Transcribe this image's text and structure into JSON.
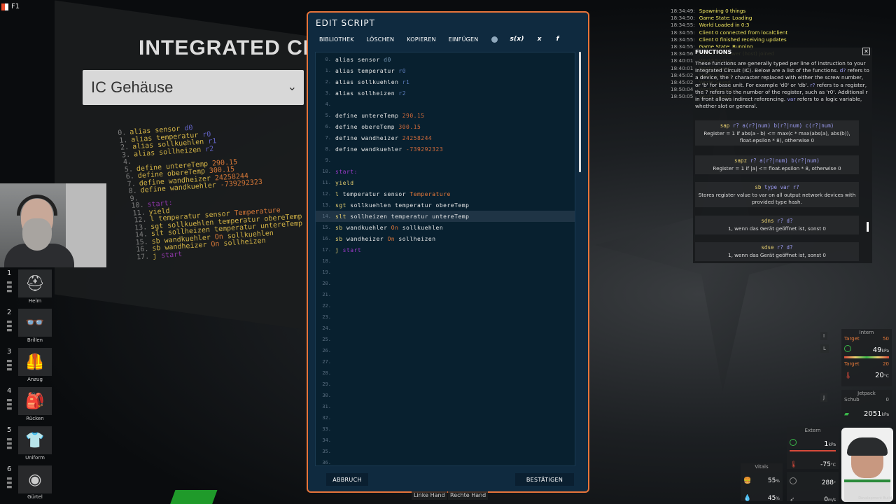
{
  "top_left": {
    "key": "F1"
  },
  "background": {
    "title": "INTEGRATED CIRCUIT",
    "selector_value": "IC Gehäuse"
  },
  "background_code": [
    {
      "n": "0.",
      "parts": [
        [
          "kw",
          "alias sensor "
        ],
        [
          "dev",
          "d0"
        ]
      ]
    },
    {
      "n": "1.",
      "parts": [
        [
          "kw",
          "alias temperatur "
        ],
        [
          "reg",
          "r0"
        ]
      ]
    },
    {
      "n": "2.",
      "parts": [
        [
          "kw",
          "alias sollkuehlen "
        ],
        [
          "reg",
          "r1"
        ]
      ]
    },
    {
      "n": "3.",
      "parts": [
        [
          "kw",
          "alias sollheizen "
        ],
        [
          "reg",
          "r2"
        ]
      ]
    },
    {
      "n": "4.",
      "parts": []
    },
    {
      "n": "5.",
      "parts": [
        [
          "kw",
          "define untereTemp "
        ],
        [
          "num",
          "290.15"
        ]
      ]
    },
    {
      "n": "6.",
      "parts": [
        [
          "kw",
          "define obereTemp "
        ],
        [
          "num",
          "300.15"
        ]
      ]
    },
    {
      "n": "7.",
      "parts": [
        [
          "kw",
          "define wandheizer "
        ],
        [
          "num",
          "24258244"
        ]
      ]
    },
    {
      "n": "8.",
      "parts": [
        [
          "kw",
          "define wandkuehler "
        ],
        [
          "num",
          "-739292323"
        ]
      ]
    },
    {
      "n": "9.",
      "parts": []
    },
    {
      "n": "10.",
      "parts": [
        [
          "lbl",
          "start:"
        ]
      ]
    },
    {
      "n": "11.",
      "parts": [
        [
          "kw",
          "yield"
        ]
      ]
    },
    {
      "n": "12.",
      "parts": [
        [
          "kw",
          "l temperatur sensor "
        ],
        [
          "logic",
          "Temperature"
        ]
      ]
    },
    {
      "n": "13.",
      "parts": [
        [
          "kw",
          "sgt sollkuehlen temperatur obereTemp"
        ]
      ]
    },
    {
      "n": "14.",
      "parts": [
        [
          "kw",
          "slt sollheizen temperatur untereTemp"
        ]
      ]
    },
    {
      "n": "15.",
      "parts": [
        [
          "kw",
          "sb wandkuehler "
        ],
        [
          "logic",
          "On"
        ],
        [
          "kw",
          " sollkuehlen"
        ]
      ]
    },
    {
      "n": "16.",
      "parts": [
        [
          "kw",
          "sb wandheizer "
        ],
        [
          "logic",
          "On"
        ],
        [
          "kw",
          " sollheizen"
        ]
      ]
    },
    {
      "n": "17.",
      "parts": [
        [
          "kw",
          "j "
        ],
        [
          "lbl",
          "start"
        ]
      ]
    }
  ],
  "inventory": [
    {
      "num": "1",
      "label": "Helm",
      "icon": "helmet-icon",
      "glyph": "⛑"
    },
    {
      "num": "2",
      "label": "Brillen",
      "icon": "glasses-icon",
      "glyph": "👓"
    },
    {
      "num": "3",
      "label": "Anzug",
      "icon": "suit-icon",
      "glyph": "🦺"
    },
    {
      "num": "4",
      "label": "Rücken",
      "icon": "backpack-icon",
      "glyph": "🎒"
    },
    {
      "num": "5",
      "label": "Uniform",
      "icon": "uniform-icon",
      "glyph": "👕"
    },
    {
      "num": "6",
      "label": "Gürtel",
      "icon": "belt-icon",
      "glyph": "◉"
    }
  ],
  "modal": {
    "title": "EDIT SCRIPT",
    "toolbar": [
      "BIBLIOTHEK",
      "LÖSCHEN",
      "KOPIEREN",
      "EINFÜGEN"
    ],
    "toolbar_icons": [
      "s(x)",
      "x",
      "f"
    ],
    "cancel": "ABBRUCH",
    "confirm": "BESTÄTIGEN",
    "active_line": 14
  },
  "code_lines": [
    {
      "n": "0.",
      "parts": [
        [
          "plain",
          "alias "
        ],
        [
          "plain",
          "sensor "
        ],
        [
          "dev",
          "d0"
        ]
      ]
    },
    {
      "n": "1.",
      "parts": [
        [
          "plain",
          "alias temperatur "
        ],
        [
          "reg",
          "r0"
        ]
      ]
    },
    {
      "n": "2.",
      "parts": [
        [
          "plain",
          "alias sollkuehlen "
        ],
        [
          "reg",
          "r1"
        ]
      ]
    },
    {
      "n": "3.",
      "parts": [
        [
          "plain",
          "alias sollheizen "
        ],
        [
          "reg",
          "r2"
        ]
      ]
    },
    {
      "n": "4.",
      "parts": []
    },
    {
      "n": "5.",
      "parts": [
        [
          "plain",
          "define untereTemp "
        ],
        [
          "num",
          "290.15"
        ]
      ]
    },
    {
      "n": "6.",
      "parts": [
        [
          "plain",
          "define obereTemp "
        ],
        [
          "num",
          "300.15"
        ]
      ]
    },
    {
      "n": "7.",
      "parts": [
        [
          "plain",
          "define wandheizer "
        ],
        [
          "num",
          "24258244"
        ]
      ]
    },
    {
      "n": "8.",
      "parts": [
        [
          "plain",
          "define wandkuehler "
        ],
        [
          "num",
          "-739292323"
        ]
      ]
    },
    {
      "n": "9.",
      "parts": []
    },
    {
      "n": "10.",
      "parts": [
        [
          "lbl",
          "start:"
        ]
      ]
    },
    {
      "n": "11.",
      "parts": [
        [
          "kw",
          "yield"
        ]
      ]
    },
    {
      "n": "12.",
      "parts": [
        [
          "kw",
          "l "
        ],
        [
          "plain",
          "temperatur sensor "
        ],
        [
          "logic",
          "Temperature"
        ]
      ]
    },
    {
      "n": "13.",
      "parts": [
        [
          "kw",
          "sgt "
        ],
        [
          "plain",
          "sollkuehlen temperatur obereTemp"
        ]
      ]
    },
    {
      "n": "14.",
      "parts": [
        [
          "kw",
          "slt "
        ],
        [
          "plain",
          "sollheizen temperatur untereTemp"
        ]
      ]
    },
    {
      "n": "15.",
      "parts": [
        [
          "kw",
          "sb "
        ],
        [
          "plain",
          "wandkuehler "
        ],
        [
          "logic",
          "On"
        ],
        [
          "plain",
          " sollkuehlen"
        ]
      ]
    },
    {
      "n": "16.",
      "parts": [
        [
          "kw",
          "sb "
        ],
        [
          "plain",
          "wandheizer "
        ],
        [
          "logic",
          "On"
        ],
        [
          "plain",
          " sollheizen"
        ]
      ]
    },
    {
      "n": "17.",
      "parts": [
        [
          "kw",
          "j "
        ],
        [
          "lbl",
          "start"
        ]
      ]
    },
    {
      "n": "18.",
      "parts": []
    },
    {
      "n": "19.",
      "parts": []
    },
    {
      "n": "20.",
      "parts": []
    },
    {
      "n": "21.",
      "parts": []
    },
    {
      "n": "22.",
      "parts": []
    },
    {
      "n": "23.",
      "parts": []
    },
    {
      "n": "24.",
      "parts": []
    },
    {
      "n": "25.",
      "parts": []
    },
    {
      "n": "26.",
      "parts": []
    },
    {
      "n": "27.",
      "parts": []
    },
    {
      "n": "28.",
      "parts": []
    },
    {
      "n": "29.",
      "parts": []
    },
    {
      "n": "30.",
      "parts": []
    },
    {
      "n": "31.",
      "parts": []
    },
    {
      "n": "32.",
      "parts": []
    },
    {
      "n": "33.",
      "parts": []
    },
    {
      "n": "34.",
      "parts": []
    },
    {
      "n": "35.",
      "parts": []
    },
    {
      "n": "36.",
      "parts": []
    }
  ],
  "log": [
    {
      "ts": "18:34:49:",
      "msg": "Spawning 0 things"
    },
    {
      "ts": "18:34:50:",
      "msg": "Game State: Loading"
    },
    {
      "ts": "18:34:55:",
      "msg": "World Loaded in 0:3"
    },
    {
      "ts": "18:34:55:",
      "msg": "Client 0 connected from localClient"
    },
    {
      "ts": "18:34:55:",
      "msg": "Client 0 finished receiving updates"
    },
    {
      "ts": "18:34:55:",
      "msg": "Game State: Running"
    },
    {
      "ts": "18:34:56:",
      "msg": "Player Funpower (host) joined"
    },
    {
      "ts": "18:40:01:",
      "msg": "World Saving"
    },
    {
      "ts": "18:40:01:",
      "msg": "World Saved"
    },
    {
      "ts": "18:45:02:",
      "msg": "World Saving"
    },
    {
      "ts": "18:45:02:",
      "msg": "World Saved"
    },
    {
      "ts": "18:50:04:",
      "msg": "World Saving"
    },
    {
      "ts": "18:50:05:",
      "msg": "World Saved"
    }
  ],
  "functions": {
    "title": "FUNCTIONS",
    "intro_a": "These functions are generally typed per line of instruction to your Integrated Circuit (IC). Below are a list of the functions. ",
    "intro_hl1": "d?",
    "intro_b": " refers to a device, the ? character replaced with either the screw number, or 'b' for base unit. For example 'd0' or 'db'. ",
    "intro_hl2": "r?",
    "intro_c": " refers to a register, the ? refers to the number of the register, such as 'r0'. Additional r in front allows indirect referencing. ",
    "intro_hl3": "var",
    "intro_d": " refers to a logic variable, whether slot or general.",
    "cards": [
      {
        "op": "sap",
        "args": " r? a(r?|num) b(r?|num) c(r?|num)",
        "desc": "Register = 1 if abs(a - b) <= max(c * max(abs(a), abs(b)), float.epsilon * 8), otherwise 0"
      },
      {
        "op": "sapz",
        "args": " r? a(r?|num) b(r?|num)",
        "desc": "Register = 1 if |a| <= float.epsilon * 8, otherwise 0"
      },
      {
        "op": "sb",
        "args": " type var r?",
        "desc": "Stores register value to var on all output network devices with provided type hash."
      },
      {
        "op": "sdns",
        "args": " r? d?",
        "desc": "1, wenn das Gerät geöffnet ist, sonst 0"
      },
      {
        "op": "sdse",
        "args": " r? d?",
        "desc": "1, wenn das Gerät geöffnet ist, sonst 0"
      }
    ]
  },
  "hud": {
    "intern_label": "Intern",
    "target_label": "Target",
    "pressure_target": "50",
    "pressure_value": "49",
    "pressure_unit": "kPa",
    "temp_target": "20",
    "temp_value": "20",
    "temp_unit": "°C",
    "jetpack_label": "Jetpack",
    "schub_label": "Schub",
    "schub_value": "0",
    "jetpack_pressure": "2051",
    "jetpack_unit": "kPa",
    "extern_label": "Extern",
    "extern_pressure": "1",
    "extern_pressure_unit": "kPa",
    "extern_temp": "-75",
    "extern_temp_unit": "°C",
    "vitals_label": "Vitals",
    "food": "55",
    "water": "45",
    "pct": "%",
    "heading": "288",
    "heading_unit": "°",
    "speed": "0",
    "speed_unit": "m/s",
    "key_i": "I",
    "key_l": "L",
    "key_j": "J",
    "dev_build": "Development Build"
  },
  "hands": {
    "left": "Linke Hand",
    "right": "Rechte Hand"
  }
}
